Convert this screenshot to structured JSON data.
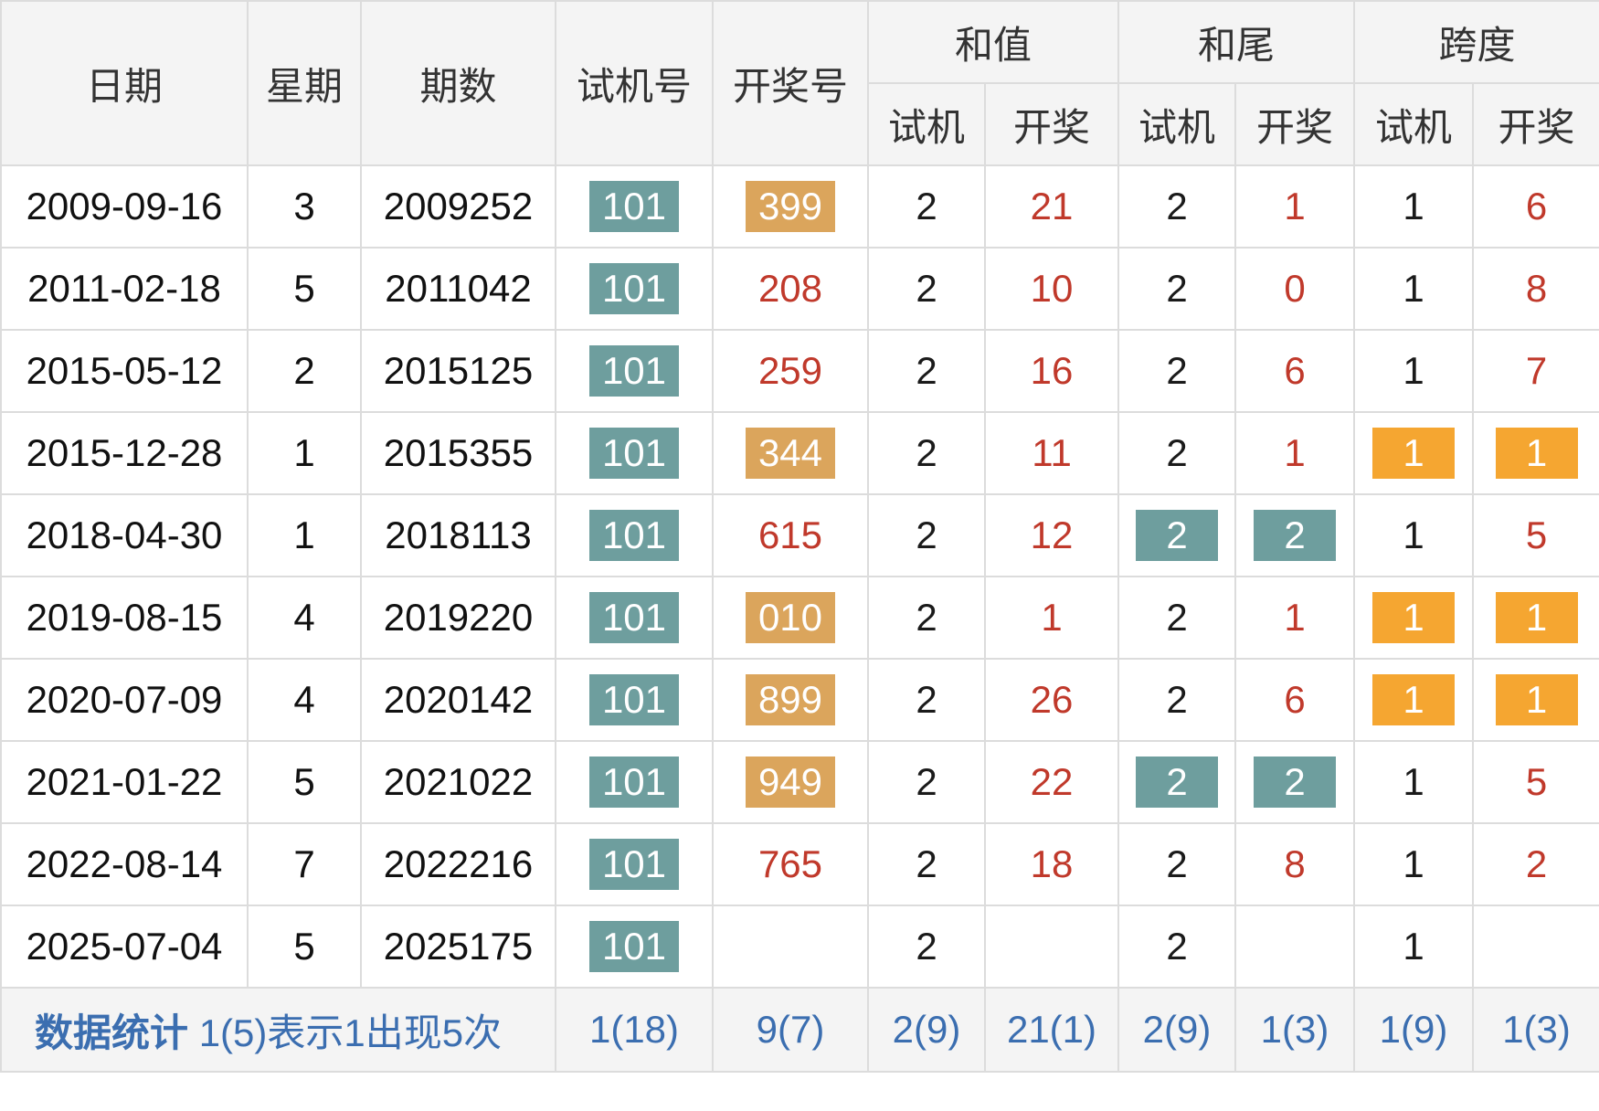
{
  "header": {
    "date": "日期",
    "week": "星期",
    "issue": "期数",
    "test_number": "试机号",
    "draw_number": "开奖号",
    "sum_group": "和值",
    "tail_group": "和尾",
    "span_group": "跨度",
    "sub_test": "试机",
    "sub_draw": "开奖"
  },
  "rows": [
    {
      "date": "2009-09-16",
      "week": "3",
      "issue": "2009252",
      "test": "101",
      "draw": "399",
      "sum_test": "2",
      "sum_draw": "21",
      "tail_test": "2",
      "tail_draw": "1",
      "span_test": "1",
      "span_draw": "6"
    },
    {
      "date": "2011-02-18",
      "week": "5",
      "issue": "2011042",
      "test": "101",
      "draw": "208",
      "sum_test": "2",
      "sum_draw": "10",
      "tail_test": "2",
      "tail_draw": "0",
      "span_test": "1",
      "span_draw": "8"
    },
    {
      "date": "2015-05-12",
      "week": "2",
      "issue": "2015125",
      "test": "101",
      "draw": "259",
      "sum_test": "2",
      "sum_draw": "16",
      "tail_test": "2",
      "tail_draw": "6",
      "span_test": "1",
      "span_draw": "7"
    },
    {
      "date": "2015-12-28",
      "week": "1",
      "issue": "2015355",
      "test": "101",
      "draw": "344",
      "sum_test": "2",
      "sum_draw": "11",
      "tail_test": "2",
      "tail_draw": "1",
      "span_test": "1",
      "span_draw": "1"
    },
    {
      "date": "2018-04-30",
      "week": "1",
      "issue": "2018113",
      "test": "101",
      "draw": "615",
      "sum_test": "2",
      "sum_draw": "12",
      "tail_test": "2",
      "tail_draw": "2",
      "span_test": "1",
      "span_draw": "5"
    },
    {
      "date": "2019-08-15",
      "week": "4",
      "issue": "2019220",
      "test": "101",
      "draw": "010",
      "sum_test": "2",
      "sum_draw": "1",
      "tail_test": "2",
      "tail_draw": "1",
      "span_test": "1",
      "span_draw": "1"
    },
    {
      "date": "2020-07-09",
      "week": "4",
      "issue": "2020142",
      "test": "101",
      "draw": "899",
      "sum_test": "2",
      "sum_draw": "26",
      "tail_test": "2",
      "tail_draw": "6",
      "span_test": "1",
      "span_draw": "1"
    },
    {
      "date": "2021-01-22",
      "week": "5",
      "issue": "2021022",
      "test": "101",
      "draw": "949",
      "sum_test": "2",
      "sum_draw": "22",
      "tail_test": "2",
      "tail_draw": "2",
      "span_test": "1",
      "span_draw": "5"
    },
    {
      "date": "2022-08-14",
      "week": "7",
      "issue": "2022216",
      "test": "101",
      "draw": "765",
      "sum_test": "2",
      "sum_draw": "18",
      "tail_test": "2",
      "tail_draw": "8",
      "span_test": "1",
      "span_draw": "2"
    },
    {
      "date": "2025-07-04",
      "week": "5",
      "issue": "2025175",
      "test": "101",
      "draw": "",
      "sum_test": "2",
      "sum_draw": "",
      "tail_test": "2",
      "tail_draw": "",
      "span_test": "1",
      "span_draw": ""
    }
  ],
  "stats": {
    "label": "数据统计",
    "note": "1(5)表示1出现5次",
    "test": "1(18)",
    "draw": "9(7)",
    "sum_test": "2(9)",
    "sum_draw": "21(1)",
    "tail_test": "2(9)",
    "tail_draw": "1(3)",
    "span_test": "1(9)",
    "span_draw": "1(3)"
  },
  "colors": {
    "teal_badge": "#6e9e9e",
    "tan_badge": "#dba55c",
    "orange_badge": "#f5a631",
    "red_text": "#c0392b",
    "stat_blue": "#3b6eb0",
    "header_bg": "#f4f4f4",
    "border": "#dcdcdc"
  }
}
